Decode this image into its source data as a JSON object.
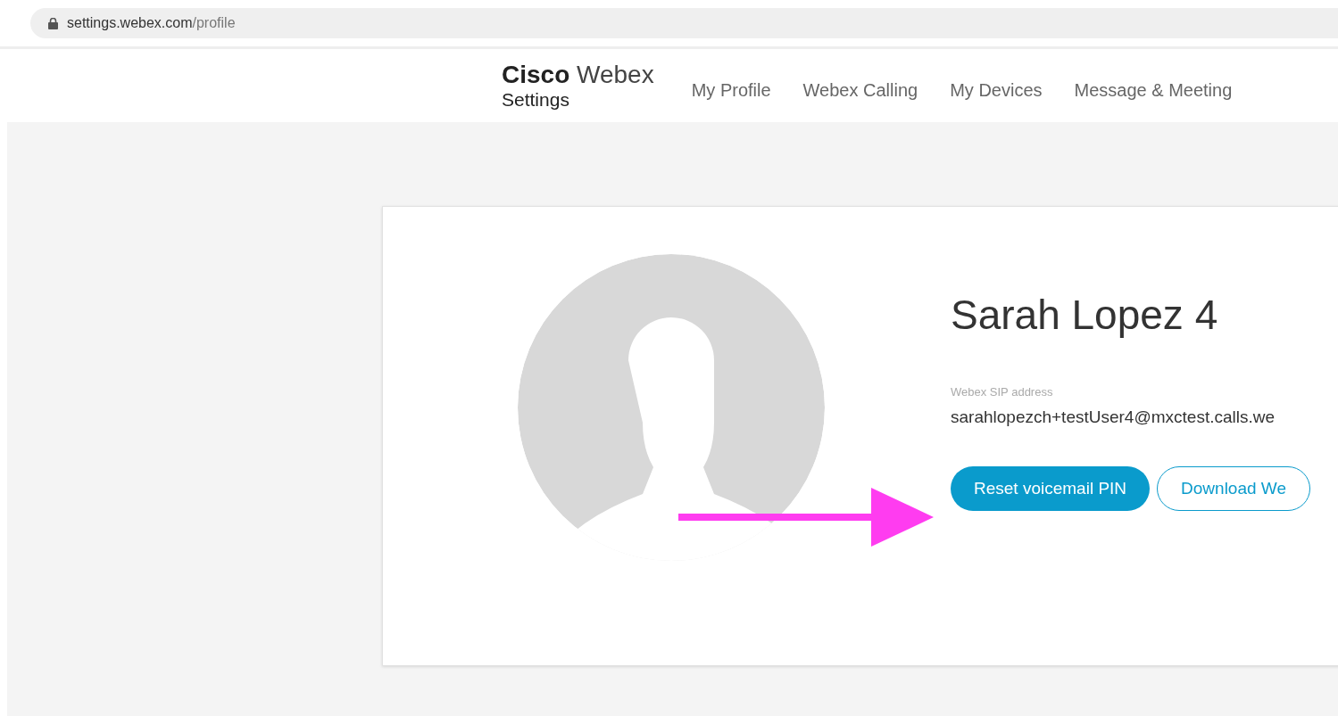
{
  "browser": {
    "url_host": "settings.webex.com",
    "url_path": "/profile"
  },
  "header": {
    "brand": "**Cisco** Webex",
    "subtitle": "Settings",
    "nav": [
      {
        "label": "My Profile"
      },
      {
        "label": "Webex Calling"
      },
      {
        "label": "My Devices"
      },
      {
        "label": "Message & Meeting"
      }
    ]
  },
  "profile": {
    "name": "Sarah Lopez 4",
    "sip_label": "Webex SIP address",
    "sip_address": "sarahlopezch+testUser4@mxctest.calls.we",
    "buttons": [
      {
        "label": "Reset voicemail PIN",
        "kind": "primary"
      },
      {
        "label": "Download We",
        "kind": "outline"
      }
    ]
  }
}
